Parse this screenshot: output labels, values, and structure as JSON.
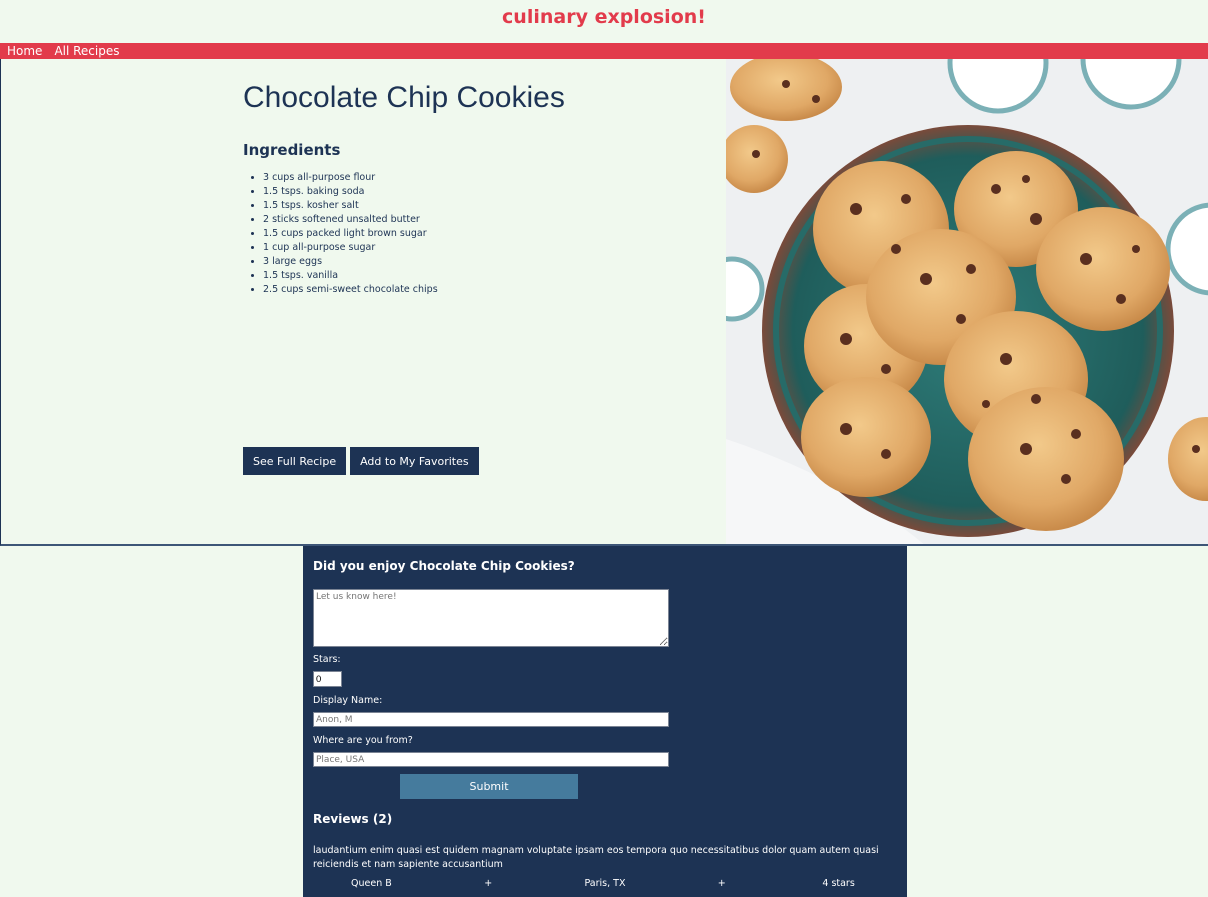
{
  "header": {
    "title": "culinary explosion!"
  },
  "nav": {
    "items": [
      {
        "label": "Home"
      },
      {
        "label": "All Recipes"
      }
    ]
  },
  "recipe": {
    "title": "Chocolate Chip Cookies",
    "ingredients_heading": "Ingredients",
    "ingredients": [
      "3 cups all-purpose flour",
      "1.5 tsps. baking soda",
      "1.5 tsps. kosher salt",
      "2 sticks softened unsalted butter",
      "1.5 cups packed light brown sugar",
      "1 cup all-purpose sugar",
      "3 large eggs",
      "1.5 tsps. vanilla",
      "2.5 cups semi-sweet chocolate chips"
    ],
    "buttons": {
      "full_recipe": "See Full Recipe",
      "favorite": "Add to My Favorites"
    }
  },
  "feedback": {
    "question": "Did you enjoy Chocolate Chip Cookies?",
    "comment_placeholder": "Let us know here!",
    "stars_label": "Stars:",
    "stars_value": "0",
    "display_name_label": "Display Name:",
    "display_name_placeholder": "Anon, M",
    "location_label": "Where are you from?",
    "location_placeholder": "Place, USA",
    "submit_label": "Submit"
  },
  "reviews": {
    "heading": "Reviews (2)",
    "items": [
      {
        "body": "laudantium enim quasi est quidem magnam voluptate ipsam eos tempora quo necessitatibus dolor quam autem quasi reiciendis et nam sapiente accusantium",
        "name": "Queen B",
        "sep1": "+",
        "location": "Paris, TX",
        "sep2": "+",
        "stars": "4 stars"
      }
    ]
  },
  "colors": {
    "brand_red": "#e23b4b",
    "navy": "#1d3354",
    "button_blue": "#457b9d",
    "page_background": "#f0f9ee"
  }
}
